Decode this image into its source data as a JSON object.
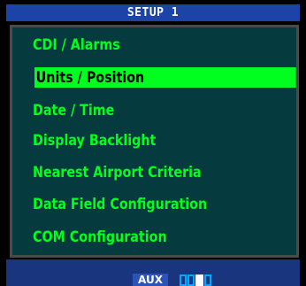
{
  "title": "SETUP 1",
  "menu": {
    "items": [
      {
        "label": "CDI / Alarms",
        "selected": false
      },
      {
        "label": "Units / Position",
        "selected": true
      },
      {
        "label": "Date / Time",
        "selected": false
      },
      {
        "label": "Display Backlight",
        "selected": false
      },
      {
        "label": "Nearest Airport Criteria",
        "selected": false
      },
      {
        "label": "Data Field Configuration",
        "selected": false
      },
      {
        "label": "COM Configuration",
        "selected": false
      }
    ]
  },
  "status": {
    "group_label": "AUX",
    "page_indicator": {
      "total": 4,
      "current": 3
    }
  },
  "colors": {
    "menu_text": "#00ff1e",
    "selection_highlight": "#00ff1e",
    "panel_background": "#053a3e",
    "title_bar": "#1c44a8",
    "status_bar": "#18357d",
    "page_box_outline": "#00aaff",
    "page_box_active": "#ffffff"
  }
}
